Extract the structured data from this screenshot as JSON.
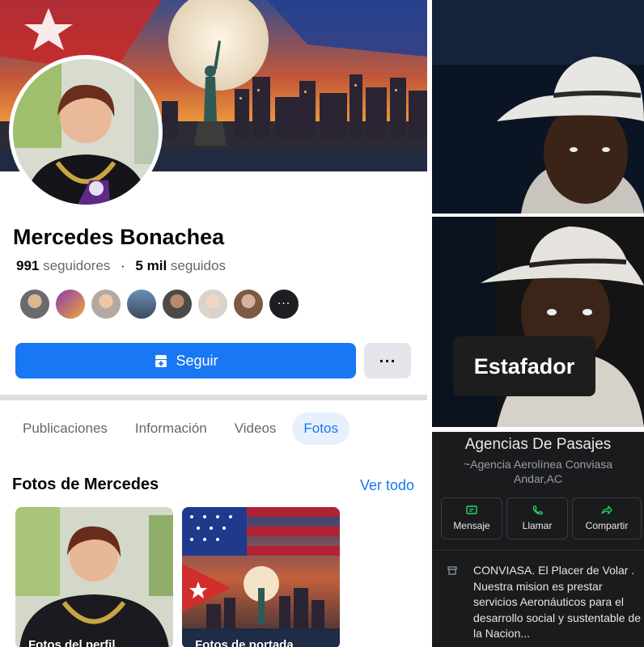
{
  "profile": {
    "name": "Mercedes Bonachea",
    "followers_count": "991",
    "followers_label": "seguidores",
    "following_count": "5 mil",
    "following_label": "seguidos"
  },
  "actions": {
    "follow_label": "Seguir",
    "more_label": "···"
  },
  "tabs": [
    {
      "label": "Publicaciones",
      "active": false
    },
    {
      "label": "Información",
      "active": false
    },
    {
      "label": "Videos",
      "active": false
    },
    {
      "label": "Fotos",
      "active": true
    }
  ],
  "photos": {
    "title": "Fotos de Mercedes",
    "see_all": "Ver todo",
    "albums": [
      {
        "label": "Fotos del perfil"
      },
      {
        "label": "Fotos de portada"
      }
    ]
  },
  "overlay": {
    "label": "Estafador"
  },
  "business": {
    "name": "Agencias De Pasajes",
    "subtitle_line1": "~Agencia Aerolínea Conviasa",
    "subtitle_line2": "Andar,AC",
    "buttons": [
      {
        "label": "Mensaje",
        "icon": "message-icon"
      },
      {
        "label": "Llamar",
        "icon": "phone-icon"
      },
      {
        "label": "Compartir",
        "icon": "share-icon"
      }
    ],
    "description": "CONVIASA. El Placer de Volar . Nuestra mision es prestar servicios Aeronáuticos para el desarrollo social y sustentable de la Nacion..."
  },
  "colors": {
    "facebook_blue": "#1877f2",
    "whatsapp_green": "#25d366"
  }
}
